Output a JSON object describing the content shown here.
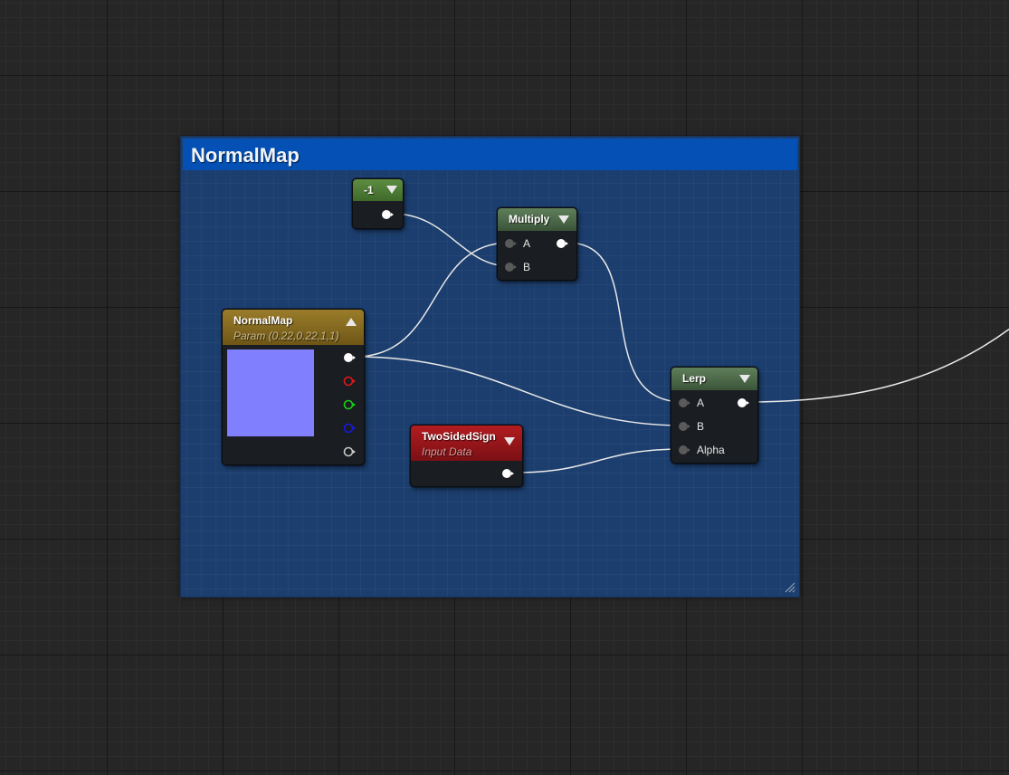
{
  "comment": {
    "title": "NormalMap",
    "color": "#0450b4"
  },
  "nodes": {
    "neg_one": {
      "title": "-1",
      "header_color": "#4e7a36"
    },
    "multiply": {
      "title": "Multiply",
      "header_color": "#4c6a48",
      "inputs": [
        "A",
        "B"
      ]
    },
    "normalmap_param": {
      "title": "NormalMap",
      "subtitle": "Param (0.22,0.22,1,1)",
      "header_color": "#8a6d22",
      "preview_color": "#8080ff",
      "outputs": [
        "rgb",
        "r",
        "g",
        "b",
        "a"
      ]
    },
    "two_sided_sign": {
      "title": "TwoSidedSign",
      "subtitle": "Input Data",
      "header_color": "#a8181c"
    },
    "lerp": {
      "title": "Lerp",
      "header_color": "#4c6a48",
      "inputs": [
        "A",
        "B",
        "Alpha"
      ]
    }
  },
  "pin_colors": {
    "white": "#ffffff",
    "red": "#e01818",
    "green": "#18d018",
    "blue": "#1818e0",
    "alpha": "#c8c8c8",
    "unconnected": "#5a5a5a"
  },
  "icons": [
    "collapse-arrow-icon",
    "expand-arrow-icon",
    "resize-grip-icon",
    "pin-icon"
  ]
}
